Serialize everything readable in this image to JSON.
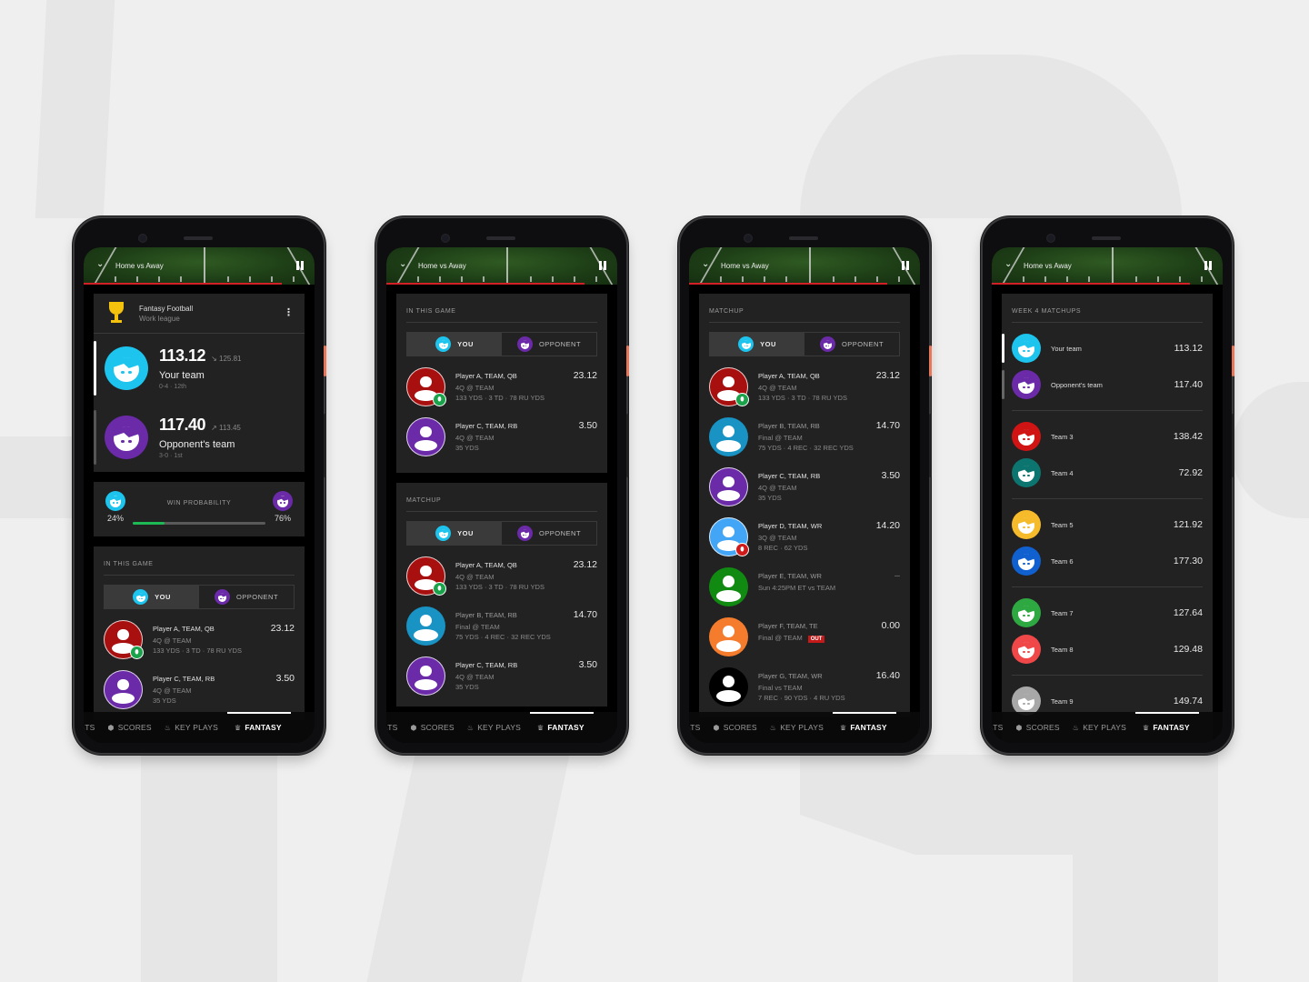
{
  "video": {
    "title": "Home vs Away",
    "progress": 0.86,
    "collapse_icon": "chevron-down-icon",
    "pause_icon": "pause-icon"
  },
  "bottom_nav": {
    "items": [
      {
        "label": "ATS",
        "icon": "",
        "active": false
      },
      {
        "label": "SCORES",
        "icon": "shield-icon",
        "active": false
      },
      {
        "label": "KEY PLAYS",
        "icon": "flame-icon",
        "active": false
      },
      {
        "label": "FANTASY",
        "icon": "trophy-icon",
        "active": true
      }
    ]
  },
  "colors": {
    "you": "#1cc4ee",
    "opponent": "#6b2aa8",
    "accent_red": "#d32027",
    "win_green": "#1db954"
  },
  "screen1": {
    "league": {
      "name": "Fantasy Football",
      "subtitle": "Work league",
      "menu_icon": "more-vert-icon"
    },
    "teams": [
      {
        "score": "113.12",
        "trend": "down",
        "projected": "125.81",
        "name": "Your team",
        "record": "0-4 · 12th",
        "color": "#1cc4ee",
        "hair": "#1cc4ee",
        "selected": true
      },
      {
        "score": "117.40",
        "trend": "up",
        "projected": "113.45",
        "name": "Opponent's team",
        "record": "3-0 · 1st",
        "color": "#6b2aa8",
        "hair": "#6b2aa8",
        "selected": false
      }
    ],
    "win_probability": {
      "title": "WIN PROBABILITY",
      "you_pct": "24%",
      "opponent_pct": "76%",
      "you_value": 0.24
    },
    "in_this_game": {
      "header": "IN THIS GAME",
      "toggle": {
        "you": "YOU",
        "opponent": "OPPONENT"
      },
      "players": [
        {
          "name": "Player A, TEAM, QB",
          "line1": "4Q @ TEAM",
          "line2": "133 YDS · 3 TD · 78 RU YDS",
          "points": "23.12",
          "color": "#a80f0f",
          "badge": "green",
          "dim": false
        },
        {
          "name": "Player C, TEAM, RB",
          "line1": "4Q @ TEAM",
          "line2": "35 YDS",
          "points": "3.50",
          "color": "#6b2aa8",
          "badge": "",
          "dim": false
        }
      ]
    }
  },
  "screen2": {
    "in_this_game": {
      "header": "IN THIS GAME",
      "toggle": {
        "you": "YOU",
        "opponent": "OPPONENT"
      },
      "players": [
        {
          "name": "Player A, TEAM, QB",
          "line1": "4Q @ TEAM",
          "line2": "133 YDS · 3 TD · 78 RU YDS",
          "points": "23.12",
          "color": "#a80f0f",
          "badge": "green",
          "dim": false
        },
        {
          "name": "Player C, TEAM, RB",
          "line1": "4Q @ TEAM",
          "line2": "35 YDS",
          "points": "3.50",
          "color": "#6b2aa8",
          "badge": "",
          "dim": false
        }
      ]
    },
    "matchup": {
      "header": "MATCHUP",
      "toggle": {
        "you": "YOU",
        "opponent": "OPPONENT"
      },
      "players": [
        {
          "name": "Player A, TEAM, QB",
          "line1": "4Q @ TEAM",
          "line2": "133 YDS · 3 TD · 78 RU YDS",
          "points": "23.12",
          "color": "#a80f0f",
          "badge": "green",
          "dim": false
        },
        {
          "name": "Player B, TEAM, RB",
          "line1": "Final @ TEAM",
          "line2": "75 YDS · 4 REC · 32 REC YDS",
          "points": "14.70",
          "color": "#1893c4",
          "badge": "",
          "dim": true
        },
        {
          "name": "Player C, TEAM, RB",
          "line1": "4Q @ TEAM",
          "line2": "35 YDS",
          "points": "3.50",
          "color": "#6b2aa8",
          "badge": "",
          "dim": false
        }
      ]
    }
  },
  "screen3": {
    "matchup": {
      "header": "MATCHUP",
      "toggle": {
        "you": "YOU",
        "opponent": "OPPONENT"
      },
      "players": [
        {
          "name": "Player A, TEAM, QB",
          "line1": "4Q @ TEAM",
          "line2": "133 YDS · 3 TD · 78 RU YDS",
          "points": "23.12",
          "color": "#a80f0f",
          "badge": "green",
          "dim": false
        },
        {
          "name": "Player B, TEAM, RB",
          "line1": "Final @ TEAM",
          "line2": "75 YDS · 4 REC · 32 REC YDS",
          "points": "14.70",
          "color": "#1893c4",
          "badge": "",
          "dim": true
        },
        {
          "name": "Player C, TEAM, RB",
          "line1": "4Q @ TEAM",
          "line2": "35 YDS",
          "points": "3.50",
          "color": "#6b2aa8",
          "badge": "",
          "dim": false
        },
        {
          "name": "Player D, TEAM, WR",
          "line1": "3Q @ TEAM",
          "line2": "8 REC · 62 YDS",
          "points": "14.20",
          "color": "#42a5f5",
          "badge": "red",
          "dim": false
        },
        {
          "name": "Player E, TEAM, WR",
          "line1": "Sun 4:25PM ET vs TEAM",
          "line2": "",
          "points": "–",
          "color": "#118a11",
          "badge": "",
          "dim": true
        },
        {
          "name": "Player F, TEAM, TE",
          "line1": "Final @ TEAM",
          "line2": "",
          "points": "0.00",
          "color": "#f57c2c",
          "badge": "",
          "dim": true,
          "status": "OUT"
        },
        {
          "name": "Player G, TEAM, WR",
          "line1": "Final vs TEAM",
          "line2": "7 REC · 90 YDS · 4 RU YDS",
          "points": "16.40",
          "color": "#000000",
          "badge": "",
          "dim": true
        }
      ]
    }
  },
  "screen4": {
    "header": "WEEK 4 MATCHUPS",
    "matchups": [
      [
        {
          "name": "Your team",
          "score": "113.12",
          "color": "#1cc4ee",
          "bar": "#ffffff"
        },
        {
          "name": "Opponent's team",
          "score": "117.40",
          "color": "#6b2aa8",
          "bar": "#666666"
        }
      ],
      [
        {
          "name": "Team 3",
          "score": "138.42",
          "color": "#d01414",
          "bar": ""
        },
        {
          "name": "Team 4",
          "score": "72.92",
          "color": "#0d7570",
          "bar": ""
        }
      ],
      [
        {
          "name": "Team 5",
          "score": "121.92",
          "color": "#f5bb2a",
          "bar": ""
        },
        {
          "name": "Team 6",
          "score": "177.30",
          "color": "#1060d0",
          "bar": ""
        }
      ],
      [
        {
          "name": "Team 7",
          "score": "127.64",
          "color": "#2ea840",
          "bar": ""
        },
        {
          "name": "Team 8",
          "score": "129.48",
          "color": "#f04848",
          "bar": ""
        }
      ],
      [
        {
          "name": "Team 9",
          "score": "149.74",
          "color": "#a8a8a8",
          "bar": ""
        }
      ]
    ]
  }
}
